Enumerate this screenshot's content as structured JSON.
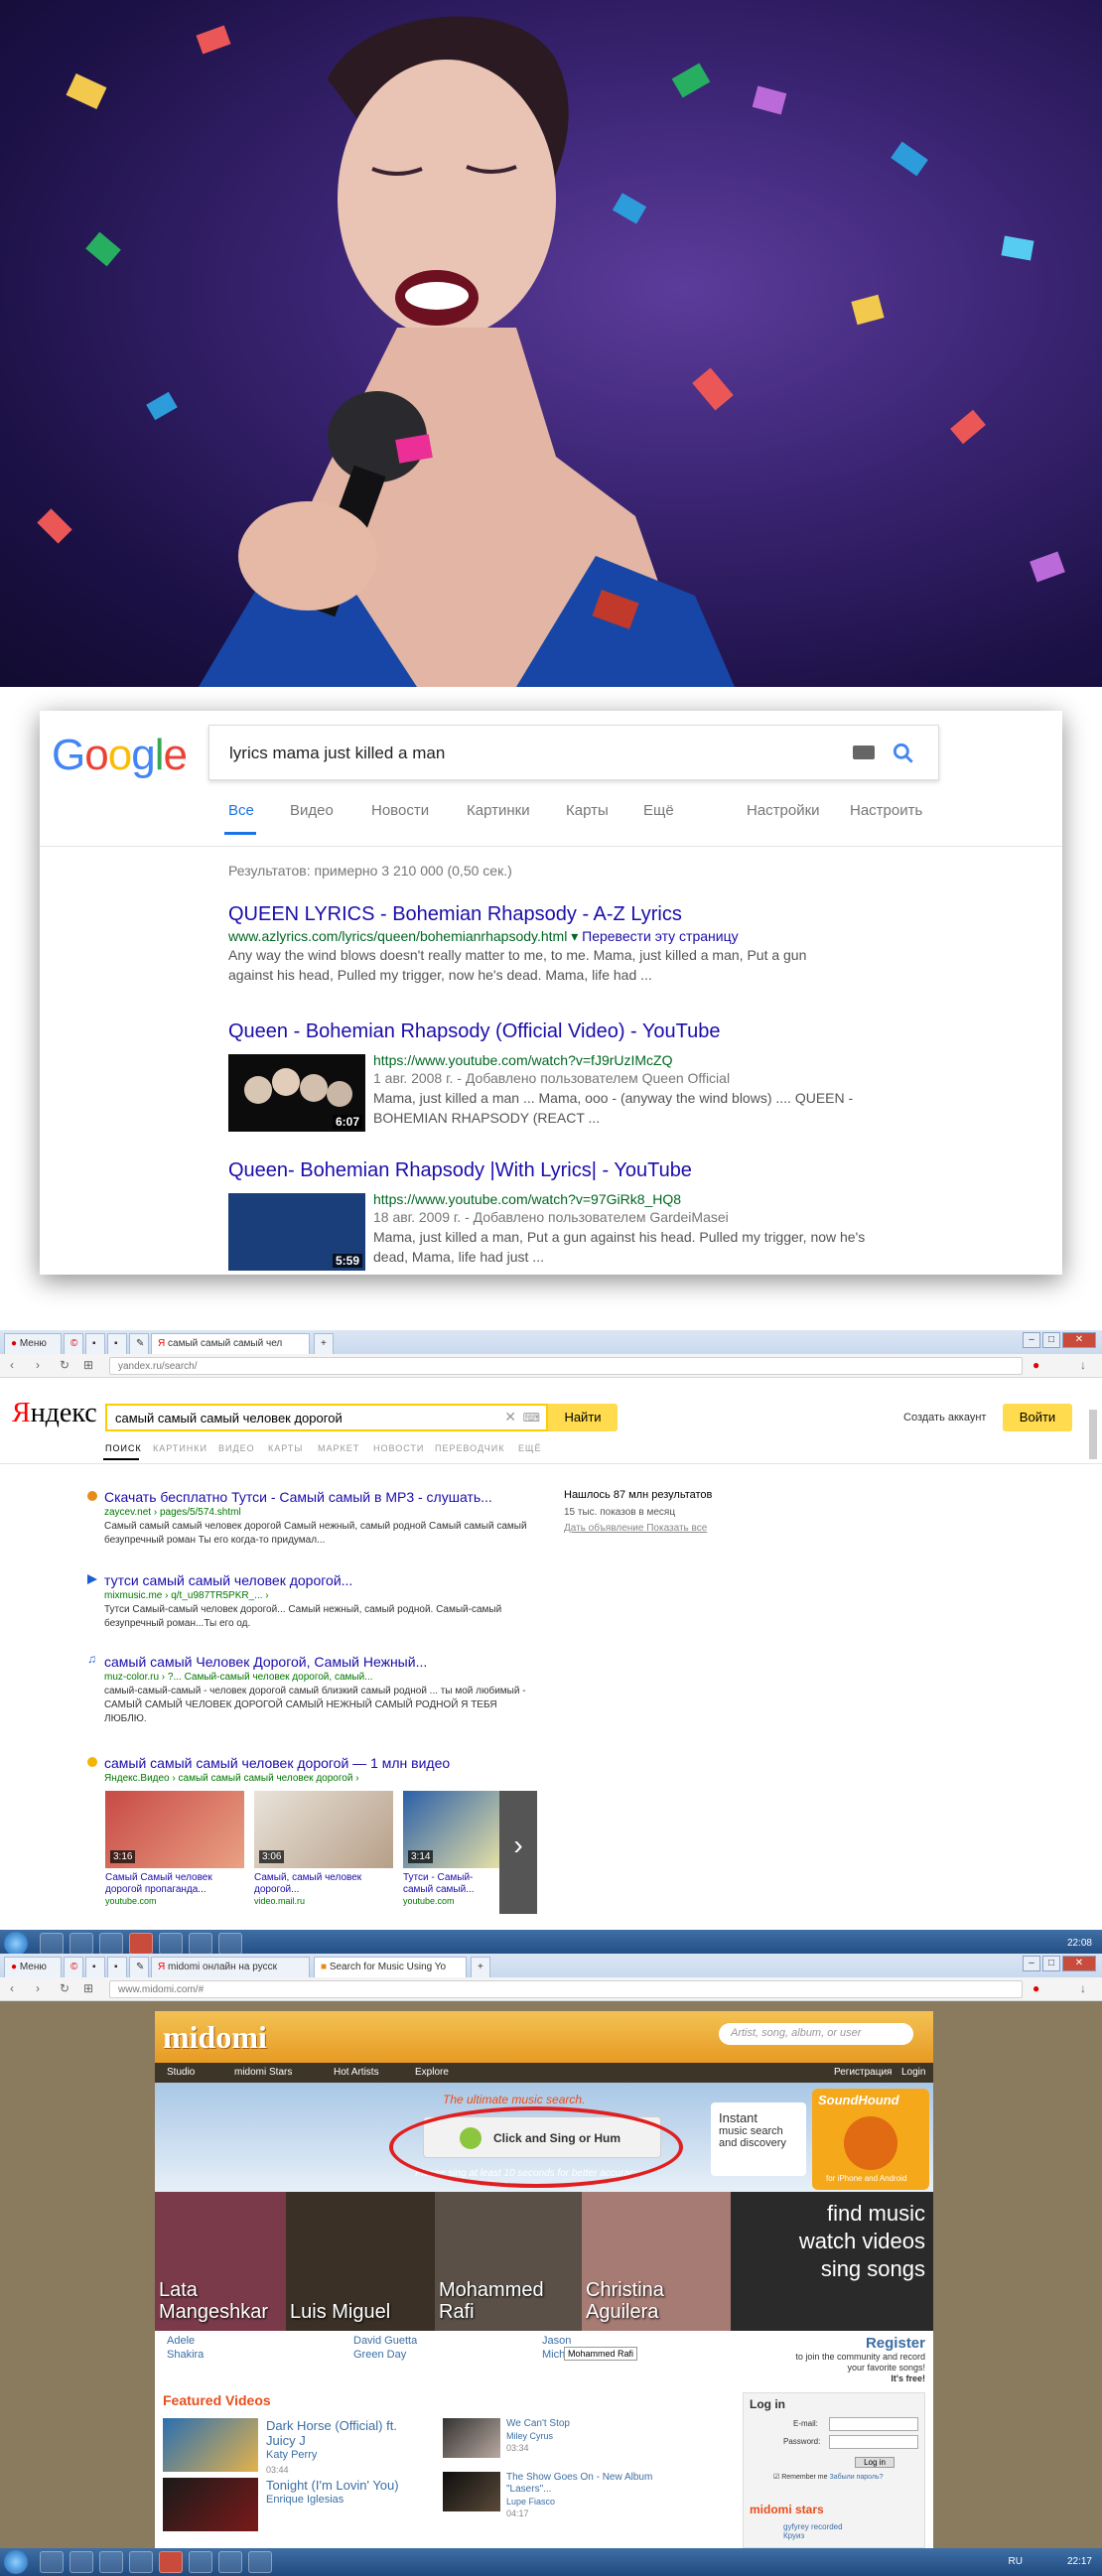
{
  "google": {
    "logo": "Google",
    "query": "lyrics mama just killed a man",
    "tabs": [
      "Все",
      "Видео",
      "Новости",
      "Картинки",
      "Карты",
      "Ещё",
      "Настройки",
      "Настроить"
    ],
    "stats": "Результатов: примерно 3 210 000 (0,50 сек.)",
    "results": [
      {
        "title": "QUEEN LYRICS - Bohemian Rhapsody - A-Z Lyrics",
        "url": "www.azlyrics.com/lyrics/queen/bohemianrhapsody.html",
        "translate": "Перевести эту страницу",
        "snippet_line1": "Any way the wind blows doesn't really matter to me, to me. Mama, just killed a man, Put a gun",
        "snippet_line2": "against his head, Pulled my trigger, now he's dead. Mama, life had ..."
      },
      {
        "title": "Queen - Bohemian Rhapsody (Official Video) - YouTube",
        "url": "https://www.youtube.com/watch?v=fJ9rUzIMcZQ",
        "meta": "1 авг. 2008 г. - Добавлено пользователем Queen Official",
        "snippet_line1": "Mama, just killed a man ... Mama, ooo - (anyway the wind blows) .... QUEEN -",
        "snippet_line2": "BOHEMIAN RHAPSODY (REACT ...",
        "duration": "6:07"
      },
      {
        "title": "Queen- Bohemian Rhapsody |With Lyrics| - YouTube",
        "url": "https://www.youtube.com/watch?v=97GiRk8_HQ8",
        "meta": "18 авг. 2009 г. - Добавлено пользователем GardeiMasei",
        "snippet_line1": "Mama, just killed a man, Put a gun against his head. Pulled my trigger, now he's",
        "snippet_line2": "dead, Mama, life had just ...",
        "duration": "5:59"
      }
    ]
  },
  "yandex": {
    "tabs": [
      {
        "label": "Меню"
      },
      {
        "label": "самый самый самый чел"
      }
    ],
    "address": "yandex.ru/search/",
    "logo_first": "Я",
    "logo_rest": "ндекс",
    "query": "самый самый самый человек дорогой",
    "search_button": "Найти",
    "create_account": "Создать аккаунт",
    "login": "Войти",
    "nav": [
      "ПОИСК",
      "КАРТИНКИ",
      "ВИДЕО",
      "КАРТЫ",
      "МАРКЕТ",
      "НОВОСТИ",
      "ПЕРЕВОДЧИК",
      "ЕЩЁ"
    ],
    "count": "Нашлось 87 млн результатов",
    "impressions": "15 тыс. показов в месяц",
    "links": "Дать объявление   Показать все",
    "results": [
      {
        "title": "Скачать бесплатно Тутси - Самый самый в MP3 - слушать...",
        "url": "zaycev.net › pages/5/574.shtml",
        "snippet": "Самый самый самый человек дорогой Самый нежный, самый родной Самый самый самый безупречный роман Ты его когда-то придумал..."
      },
      {
        "title": "тутси самый самый человек дорогой...",
        "url": "mixmusic.me › q/t_u987TR5PKR_... ›",
        "snippet": "Тутси Самый-самый человек дорогой... Самый нежный, самый родной. Самый-самый безупречный роман...Ты его од."
      },
      {
        "title": "самый самый Человек Дорогой, Самый Нежный...",
        "url": "muz-color.ru › ?... Самый-самый человек дорогой, самый...",
        "snippet": "самый-самый-самый - человек дорогой самый близкий самый родной ... ты мой любимый - САМЫЙ САМЫЙ ЧЕЛОВЕК ДОРОГОЙ САМЫЙ НЕЖНЫЙ САМЫЙ РОДНОЙ Я ТЕБЯ ЛЮБЛЮ."
      },
      {
        "title": "самый самый самый человек дорогой — 1 млн видео",
        "url": "Яндекс.Видео › самый самый самый человек дорогой ›",
        "snippet": ""
      }
    ],
    "videos": [
      {
        "duration": "3:16",
        "caption": "Самый Самый человек дорогой пропаганда...",
        "source": "youtube.com"
      },
      {
        "duration": "3:06",
        "caption": "Самый, самый человек дорогой...",
        "source": "video.mail.ru"
      },
      {
        "duration": "3:14",
        "caption": "Тутси - Самый-самый самый...",
        "source": "youtube.com"
      }
    ],
    "taskbar_time": "22:08"
  },
  "midomi": {
    "tabs": [
      {
        "label": "Меню"
      },
      {
        "label": "midomi онлайн на русск"
      },
      {
        "label": "Search for Music Using Yo"
      }
    ],
    "address": "www.midomi.com/#",
    "logo": "midomi",
    "search_placeholder": "Artist, song, album, or user",
    "register_top": "Регистрация",
    "login_top": "Login",
    "nav": [
      "Studio",
      "midomi Stars",
      "Hot Artists",
      "Explore"
    ],
    "tagline": "The ultimate music search.",
    "sing_button": "Click and Sing or Hum",
    "sing_note": "Please sing at least 10 seconds for better accuracy",
    "instant_line1": "Instant",
    "instant_line2": "music search",
    "instant_line3": "and discovery",
    "soundhound": "SoundHound",
    "soundhound_for": "for iPhone and Android",
    "artists": [
      {
        "name_line1": "Lata",
        "name_line2": "Mangeshkar",
        "color": "#7a3a4a"
      },
      {
        "name_line1": "",
        "name_line2": "Luis Miguel",
        "color": "#3a3026"
      },
      {
        "name_line1": "Mohammed",
        "name_line2": "Rafi",
        "color": "#5a5048"
      },
      {
        "name_line1": "Christina",
        "name_line2": "Aguilera",
        "color": "#a67b73"
      }
    ],
    "find": [
      "find music",
      "watch videos",
      "sing songs"
    ],
    "links": [
      "Adele",
      "Shakira",
      "David Guetta",
      "Green Day",
      "Jason",
      "Michael Jackson"
    ],
    "tooltip": "Mohammed Rafi",
    "register": "Register",
    "register_sub1": "to join the community and record",
    "register_sub2": "your favorite songs!",
    "register_sub3": "It's free!",
    "featured": "Featured Videos",
    "featured_videos": [
      {
        "title": "Dark Horse (Official) ft. Juicy J",
        "artist": "Katy Perry",
        "duration": "03:44"
      },
      {
        "title": "Tonight (I'm Lovin' You)",
        "artist": "Enrique Iglesias",
        "duration": ""
      },
      {
        "title": "We Can't Stop",
        "artist": "Miley Cyrus",
        "duration": "03:34"
      },
      {
        "title": "The Show Goes On - New Album \"Lasers\"...",
        "artist": "Lupe Fiasco",
        "duration": "04:17"
      }
    ],
    "login_heading": "Log in",
    "email_label": "E-mail:",
    "password_label": "Password:",
    "login_button": "Log in",
    "remember": "Remember me",
    "forgot": "Забыли пароль?",
    "stars_heading": "midomi stars",
    "stars_line": "gyfyrey recorded",
    "stars_line2": "Круиз",
    "taskbar_lang": "RU",
    "taskbar_time": "22:17"
  }
}
